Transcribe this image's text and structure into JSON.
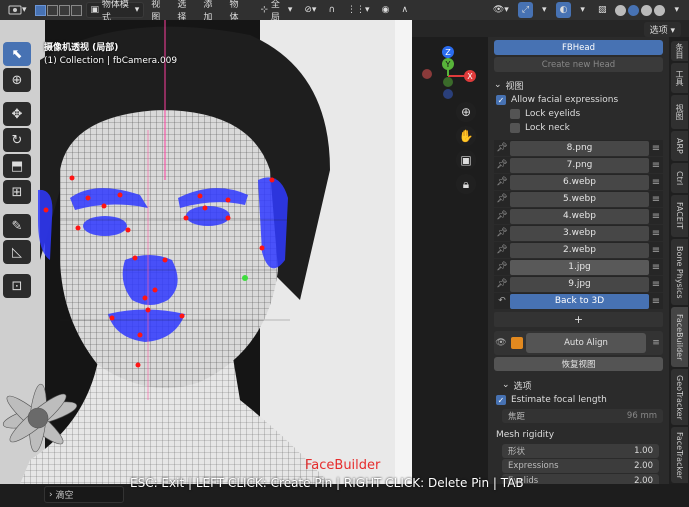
{
  "header": {
    "mode_label": "物体模式",
    "menu": [
      "视图",
      "选择",
      "添加",
      "物体"
    ],
    "orientation": "全局",
    "options_label": "选项"
  },
  "viewport": {
    "camera_title": "摄像机透视 (局部)",
    "collection_line": "(1) Collection | fbCamera.009",
    "watermark": "FaceBuilder",
    "status_hint": "ESC: Exit | LEFT CLICK: Create Pin | RIGHT CLICK: Delete Pin | TAB",
    "gizmo": {
      "z": "Z",
      "y": "Y",
      "x": "X"
    },
    "scene_pill": "滴空"
  },
  "npanel": {
    "fbhead_button": "FBHead",
    "create_head_button": "Create new Head",
    "view_section": "视图",
    "allow_expressions": "Allow facial expressions",
    "lock_eyelids": "Lock eyelids",
    "lock_neck": "Lock neck",
    "images": [
      "8.png",
      "7.png",
      "6.webp",
      "5.webp",
      "4.webp",
      "3.webp",
      "2.webp",
      "1.jpg",
      "9.jpg"
    ],
    "back_to_3d": "Back to 3D",
    "plus": "+",
    "auto_align": "Auto Align",
    "restore_view": "恢复视图",
    "options_section": "选项",
    "estimate_focal": "Estimate focal length",
    "focal_label": "焦距",
    "focal_value": "96 mm",
    "mesh_rigidity": "Mesh rigidity",
    "rigidity": [
      {
        "label": "形状",
        "value": "1.00"
      },
      {
        "label": "Expressions",
        "value": "2.00"
      },
      {
        "label": "Eyelids",
        "value": "2.00"
      }
    ]
  },
  "tabs": [
    "条目",
    "工具",
    "视图",
    "ARP",
    "Ctrl",
    "FACEIT",
    "Bone Physics",
    "FaceBuilder",
    "GeoTracker",
    "FaceTracker"
  ],
  "colors": {
    "accent": "#4772b3",
    "mesh_blue": "#2f39ff",
    "pin_red": "#ff1414"
  }
}
